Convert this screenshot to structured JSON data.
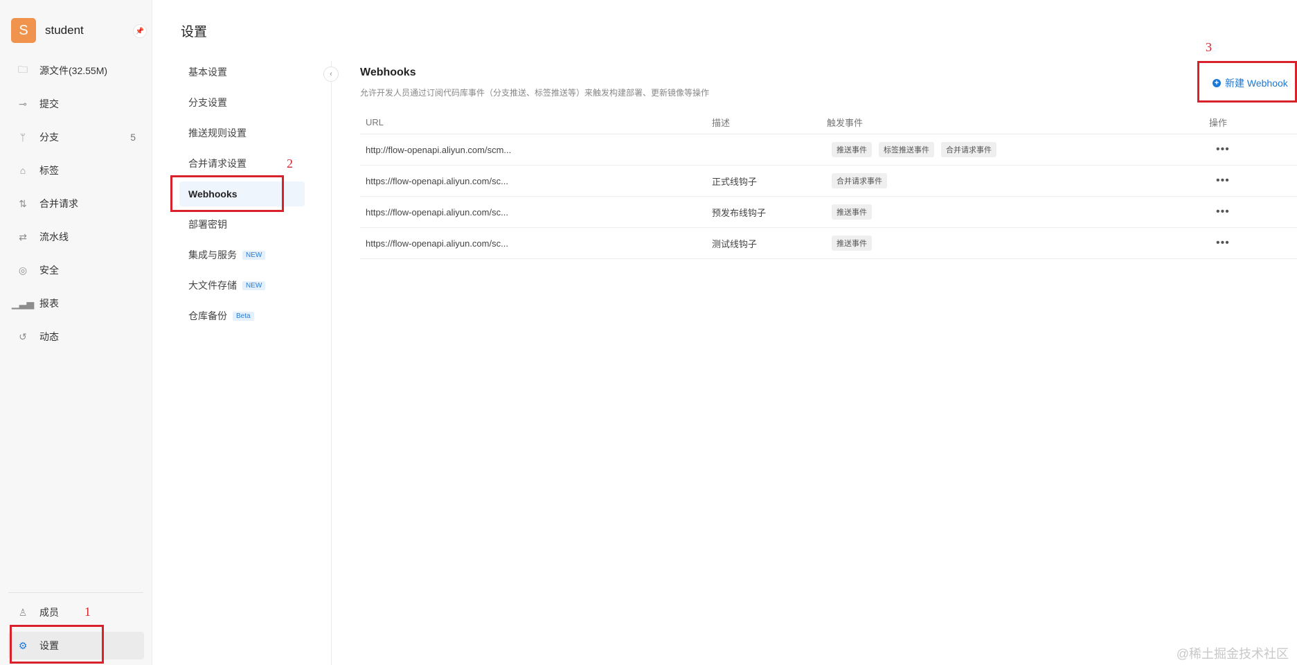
{
  "repo": {
    "avatar_letter": "S",
    "name": "student"
  },
  "sidebar": {
    "items": [
      {
        "label": "源文件(32.55M)",
        "icon": "file-icon",
        "count": ""
      },
      {
        "label": "提交",
        "icon": "commit-icon",
        "count": ""
      },
      {
        "label": "分支",
        "icon": "branch-icon",
        "count": "5"
      },
      {
        "label": "标签",
        "icon": "tag-icon",
        "count": ""
      },
      {
        "label": "合并请求",
        "icon": "merge-request-icon",
        "count": ""
      },
      {
        "label": "流水线",
        "icon": "pipeline-icon",
        "count": ""
      },
      {
        "label": "安全",
        "icon": "security-icon",
        "count": ""
      },
      {
        "label": "报表",
        "icon": "chart-icon",
        "count": ""
      },
      {
        "label": "动态",
        "icon": "history-icon",
        "count": ""
      }
    ],
    "bottom": [
      {
        "label": "成员",
        "icon": "user-icon"
      },
      {
        "label": "设置",
        "icon": "gear-icon",
        "active": true
      }
    ]
  },
  "page": {
    "title": "设置"
  },
  "settings_nav": {
    "items": [
      {
        "label": "基本设置",
        "badge": ""
      },
      {
        "label": "分支设置",
        "badge": ""
      },
      {
        "label": "推送规则设置",
        "badge": ""
      },
      {
        "label": "合并请求设置",
        "badge": ""
      },
      {
        "label": "Webhooks",
        "badge": "",
        "active": true
      },
      {
        "label": "部署密钥",
        "badge": ""
      },
      {
        "label": "集成与服务",
        "badge": "NEW"
      },
      {
        "label": "大文件存储",
        "badge": "NEW"
      },
      {
        "label": "仓库备份",
        "badge": "Beta"
      }
    ]
  },
  "webhooks": {
    "title": "Webhooks",
    "description": "允许开发人员通过订阅代码库事件（分支推送、标签推送等）来触发构建部署、更新镜像等操作",
    "new_button": "新建 Webhook",
    "columns": {
      "url": "URL",
      "desc": "描述",
      "events": "触发事件",
      "ops": "操作"
    },
    "rows": [
      {
        "url": "http://flow-openapi.aliyun.com/scm...",
        "desc": "",
        "events": [
          "推送事件",
          "标签推送事件",
          "合并请求事件"
        ]
      },
      {
        "url": "https://flow-openapi.aliyun.com/sc...",
        "desc": "正式线钩子",
        "events": [
          "合并请求事件"
        ]
      },
      {
        "url": "https://flow-openapi.aliyun.com/sc...",
        "desc": "预发布线钩子",
        "events": [
          "推送事件"
        ]
      },
      {
        "url": "https://flow-openapi.aliyun.com/sc...",
        "desc": "测试线钩子",
        "events": [
          "推送事件"
        ]
      }
    ],
    "more_glyph": "•••"
  },
  "annotations": {
    "one": "1",
    "two": "2",
    "three": "3"
  },
  "watermark": "@稀土掘金技术社区",
  "colors": {
    "accent": "#1b78d6",
    "annotation": "#d9212c",
    "avatar": "#f0944d"
  }
}
